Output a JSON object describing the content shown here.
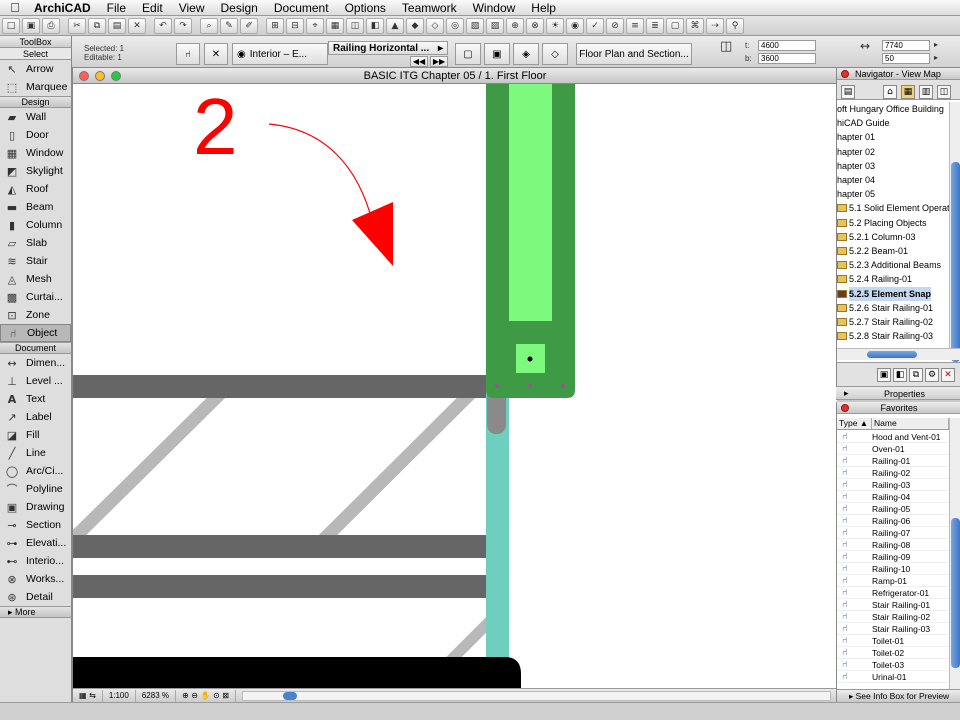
{
  "menubar": {
    "app_name": "ArchiCAD",
    "items": [
      "File",
      "Edit",
      "View",
      "Design",
      "Document",
      "Options",
      "Teamwork",
      "Window",
      "Help"
    ]
  },
  "infobar": {
    "selected": "Selected: 1",
    "editable": "Editable: 1",
    "layer": "Interior – E...",
    "object_name": "Railing Horizontal ...",
    "view_button": "Floor Plan and Section...",
    "field_1_label": "t:",
    "field_1_value": "4600",
    "field_2_label": "b:",
    "field_2_value": "3600",
    "field_3_value": "7740",
    "field_4_value": "50"
  },
  "toolbox": {
    "title": "ToolBox",
    "select": "Select",
    "top_tools": [
      {
        "label": "Arrow",
        "icon": "arrow-icon"
      },
      {
        "label": "Marquee",
        "icon": "marquee-icon"
      }
    ],
    "design_label": "Design",
    "design_tools": [
      {
        "label": "Wall",
        "icon": "wall-icon"
      },
      {
        "label": "Door",
        "icon": "door-icon"
      },
      {
        "label": "Window",
        "icon": "window-icon"
      },
      {
        "label": "Skylight",
        "icon": "skylight-icon"
      },
      {
        "label": "Roof",
        "icon": "roof-icon"
      },
      {
        "label": "Beam",
        "icon": "beam-icon"
      },
      {
        "label": "Column",
        "icon": "column-icon"
      },
      {
        "label": "Slab",
        "icon": "slab-icon"
      },
      {
        "label": "Stair",
        "icon": "stair-icon"
      },
      {
        "label": "Mesh",
        "icon": "mesh-icon"
      },
      {
        "label": "Curtai...",
        "icon": "curtain-wall-icon"
      },
      {
        "label": "Zone",
        "icon": "zone-icon"
      },
      {
        "label": "Object",
        "icon": "object-icon"
      }
    ],
    "document_label": "Document",
    "document_tools": [
      {
        "label": "Dimen...",
        "icon": "dimension-icon"
      },
      {
        "label": "Level ...",
        "icon": "level-dimension-icon"
      },
      {
        "label": "Text",
        "icon": "text-icon"
      },
      {
        "label": "Label",
        "icon": "label-icon"
      },
      {
        "label": "Fill",
        "icon": "fill-icon"
      },
      {
        "label": "Line",
        "icon": "line-icon"
      },
      {
        "label": "Arc/Ci...",
        "icon": "arc-icon"
      },
      {
        "label": "Polyline",
        "icon": "polyline-icon"
      },
      {
        "label": "Drawing",
        "icon": "drawing-icon"
      },
      {
        "label": "Section",
        "icon": "section-icon"
      },
      {
        "label": "Elevati...",
        "icon": "elevation-icon"
      },
      {
        "label": "Interio...",
        "icon": "interior-elevation-icon"
      },
      {
        "label": "Works...",
        "icon": "worksheet-icon"
      },
      {
        "label": "Detail",
        "icon": "detail-icon"
      }
    ],
    "more_label": "More"
  },
  "document": {
    "title": "BASIC ITG Chapter 05 / 1. First Floor",
    "annotation_number": "2",
    "scale": "1:100",
    "zoom": "6283 %"
  },
  "navigator": {
    "title": "Navigator - View Map",
    "items": [
      {
        "label": "oft Hungary Office Building",
        "folder": false
      },
      {
        "label": "hiCAD Guide",
        "folder": false
      },
      {
        "label": "hapter 01",
        "folder": false
      },
      {
        "label": "hapter 02",
        "folder": false
      },
      {
        "label": "hapter 03",
        "folder": false
      },
      {
        "label": "hapter 04",
        "folder": false
      },
      {
        "label": "hapter 05",
        "folder": false
      },
      {
        "label": "5.1 Solid Element Operatio",
        "folder": true
      },
      {
        "label": "5.2 Placing Objects",
        "folder": true
      },
      {
        "label": "5.2.1 Column-03",
        "folder": true
      },
      {
        "label": "5.2.2 Beam-01",
        "folder": true
      },
      {
        "label": "5.2.3 Additional Beams",
        "folder": true
      },
      {
        "label": "5.2.4 Railing-01",
        "folder": true
      },
      {
        "label": "5.2.5 Element Snap",
        "folder": true,
        "selected": true
      },
      {
        "label": "5.2.6 Stair Railing-01",
        "folder": true
      },
      {
        "label": "5.2.7 Stair Railing-02",
        "folder": true
      },
      {
        "label": "5.2.8 Stair Railing-03",
        "folder": true
      }
    ]
  },
  "properties": {
    "label": "Properties"
  },
  "favorites": {
    "title": "Favorites",
    "col_type": "Type",
    "col_name": "Name",
    "items": [
      "Hood and Vent-01",
      "Oven-01",
      "Railing-01",
      "Railing-02",
      "Railing-03",
      "Railing-04",
      "Railing-05",
      "Railing-06",
      "Railing-07",
      "Railing-08",
      "Railing-09",
      "Railing-10",
      "Ramp-01",
      "Refrigerator-01",
      "Stair Railing-01",
      "Stair Railing-02",
      "Stair Railing-03",
      "Toilet-01",
      "Toilet-02",
      "Toilet-03",
      "Urinal-01"
    ],
    "footer": "See Info Box for Preview"
  },
  "colors": {
    "green_dark": "#3f9a45",
    "green_light": "#7dfa7d",
    "teal": "#6ecfbe",
    "railing_gray": "#666666",
    "diagonal_gray": "#b8b8b8",
    "annotation_red": "#ff0000"
  }
}
